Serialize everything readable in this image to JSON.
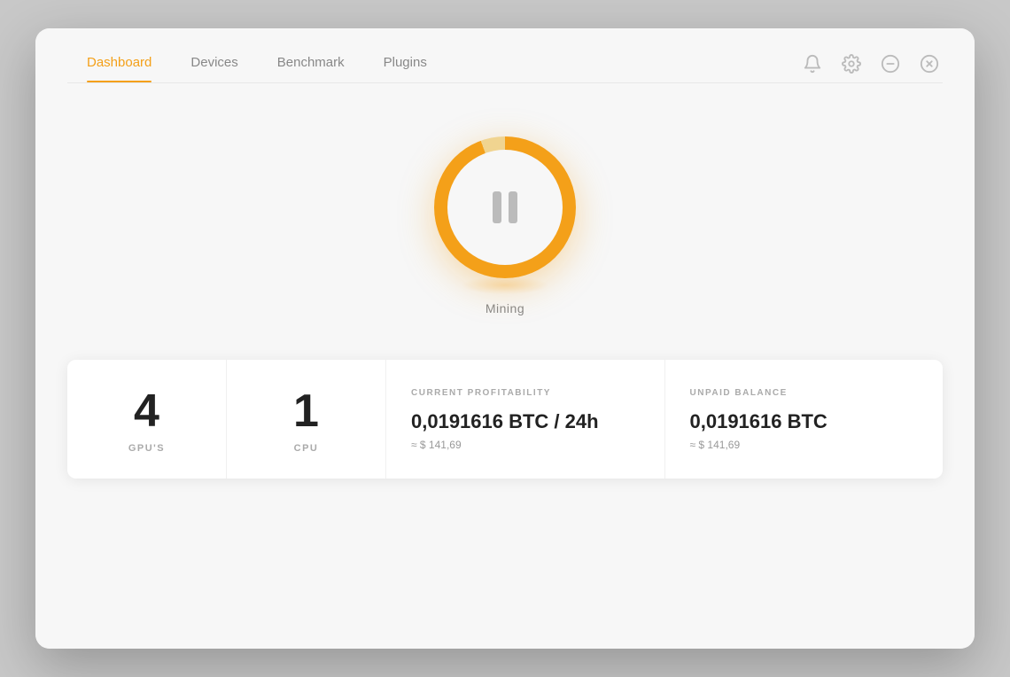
{
  "nav": {
    "items": [
      {
        "id": "dashboard",
        "label": "Dashboard",
        "active": true
      },
      {
        "id": "devices",
        "label": "Devices",
        "active": false
      },
      {
        "id": "benchmark",
        "label": "Benchmark",
        "active": false
      },
      {
        "id": "plugins",
        "label": "Plugins",
        "active": false
      }
    ],
    "icons": {
      "bell": "bell-icon",
      "gear": "gear-icon",
      "minimize": "minimize-icon",
      "close": "close-icon"
    }
  },
  "mining": {
    "state_label": "Mining"
  },
  "stats": [
    {
      "id": "gpus",
      "number": "4",
      "label": "GPU'S"
    },
    {
      "id": "cpu",
      "number": "1",
      "label": "CPU"
    },
    {
      "id": "profitability",
      "title": "CURRENT PROFITABILITY",
      "main_value": "0,0191616 BTC / 24h",
      "sub_value": "≈ $ 141,69"
    },
    {
      "id": "balance",
      "title": "UNPAID BALANCE",
      "main_value": "0,0191616 BTC",
      "sub_value": "≈ $ 141,69"
    }
  ],
  "colors": {
    "accent": "#f4a019",
    "nav_active": "#f4a019",
    "text_primary": "#222",
    "text_secondary": "#888",
    "text_muted": "#aaa"
  }
}
